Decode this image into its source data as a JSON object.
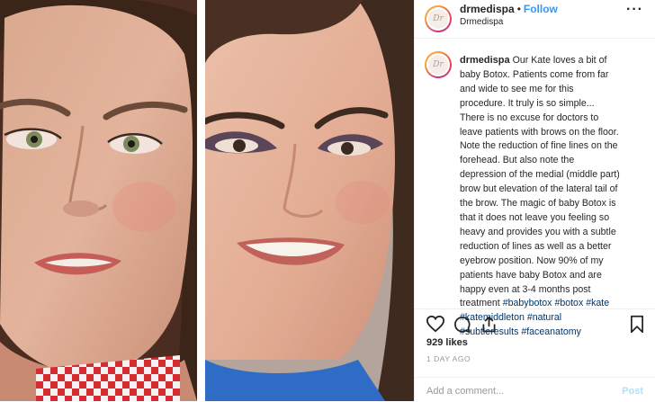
{
  "post": {
    "username": "drmedispa",
    "separator": "•",
    "follow_label": "Follow",
    "subtitle": "Drmedispa",
    "more_glyph": "···",
    "caption": {
      "username": "drmedispa",
      "lines": [
        "Our Kate loves a bit of",
        "baby Botox. Patients come from far",
        "and wide to see me for this",
        "procedure. It truly is so simple...",
        "There is no excuse for doctors to",
        "leave patients with brows on the floor.",
        "Note the reduction of fine lines on the",
        "forehead. But also note the",
        "depression of the medial (middle part)",
        "brow but elevation of the lateral tail of",
        "the brow. The magic of baby Botox is",
        "that it does not leave you feeling so",
        "heavy and provides you with a subtle",
        "reduction of lines as well as a better",
        "eyebrow position. Now 90% of my",
        "patients have baby Botox and are",
        "happy even at 3-4 months post"
      ],
      "last_line_text": "treatment",
      "hashtags": [
        "#babybotox",
        "#botox",
        "#kate",
        "#katemiddleton",
        "#natural",
        "#subtleresults",
        "#faceanatomy"
      ]
    },
    "likes": "929 likes",
    "time": "1 DAY AGO",
    "comment_placeholder": "Add a comment...",
    "post_button": "Post"
  },
  "colors": {
    "link_blue": "#3897f0",
    "hashtag": "#003569",
    "text": "#262626",
    "muted": "#999999"
  },
  "icons": [
    "heart-icon",
    "comment-icon",
    "share-icon",
    "bookmark-icon",
    "more-icon"
  ]
}
